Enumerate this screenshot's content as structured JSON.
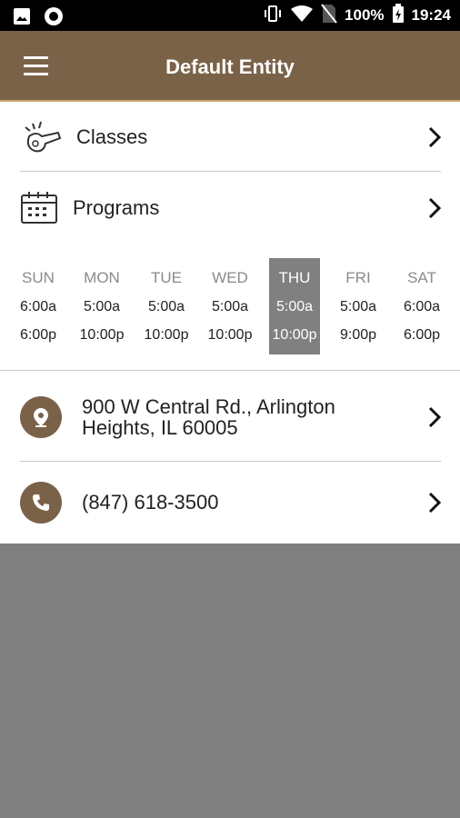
{
  "status_bar": {
    "battery": "100%",
    "time": "19:24"
  },
  "app_bar": {
    "title": "Default Entity"
  },
  "menu": {
    "classes_label": "Classes",
    "programs_label": "Programs"
  },
  "hours": [
    {
      "day": "SUN",
      "open": "6:00a",
      "close": "6:00p",
      "active": false
    },
    {
      "day": "MON",
      "open": "5:00a",
      "close": "10:00p",
      "active": false
    },
    {
      "day": "TUE",
      "open": "5:00a",
      "close": "10:00p",
      "active": false
    },
    {
      "day": "WED",
      "open": "5:00a",
      "close": "10:00p",
      "active": false
    },
    {
      "day": "THU",
      "open": "5:00a",
      "close": "10:00p",
      "active": true
    },
    {
      "day": "FRI",
      "open": "5:00a",
      "close": "9:00p",
      "active": false
    },
    {
      "day": "SAT",
      "open": "6:00a",
      "close": "6:00p",
      "active": false
    }
  ],
  "address": {
    "line1": "900 W Central Rd., Arlington",
    "line2": "Heights, IL 60005"
  },
  "phone": "(847) 618-3500",
  "colors": {
    "brand": "#7a6249",
    "accent": "#c9a76a",
    "active_day": "#808080"
  },
  "icons": [
    "image-icon",
    "record-icon",
    "vibrate-icon",
    "wifi-icon",
    "no-sim-icon",
    "battery-charging-icon",
    "menu-icon",
    "whistle-icon",
    "calendar-icon",
    "location-pin-icon",
    "phone-icon",
    "chevron-right-icon"
  ]
}
